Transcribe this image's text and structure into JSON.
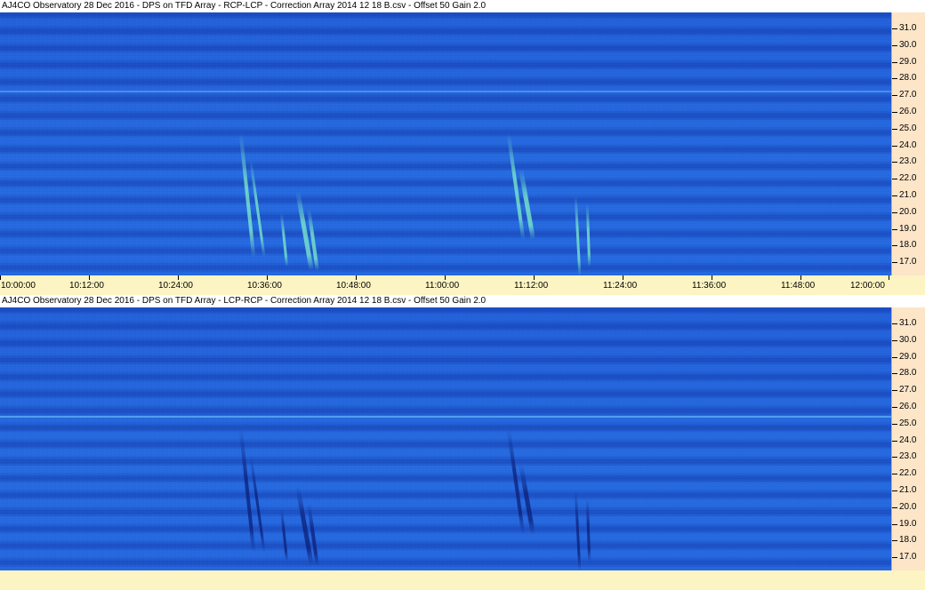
{
  "panels": [
    {
      "title": "AJ4CO Observatory 28 Dec 2016  -  DPS on TFD Array  -  RCP-LCP  -  Correction Array 2014 12 18 B.csv  -  Offset 50  Gain 2.0",
      "mode": "bright"
    },
    {
      "title": "AJ4CO Observatory 28 Dec 2016  -  DPS on TFD Array  -  LCP-RCP  -  Correction Array 2014 12 18 B.csv  -  Offset 50  Gain 2.0",
      "mode": "dark"
    }
  ],
  "freq_labels": [
    "31.0",
    "30.0",
    "29.0",
    "28.0",
    "27.0",
    "26.0",
    "25.0",
    "24.0",
    "23.0",
    "22.0",
    "21.0",
    "20.0",
    "19.0",
    "18.0",
    "17.0"
  ],
  "time_labels": [
    "10:00:00",
    "10:12:00",
    "10:24:00",
    "10:36:00",
    "10:48:00",
    "11:00:00",
    "11:12:00",
    "11:24:00",
    "11:36:00",
    "11:48:00",
    "12:00:00"
  ],
  "colors": {
    "background_blue": "#1f66e0",
    "burst_bright": "#7ff0c8",
    "burst_dark": "#0a1a70",
    "freq_axis_bg": "#fde5c8",
    "time_axis_bg": "#fdf4c3"
  }
}
